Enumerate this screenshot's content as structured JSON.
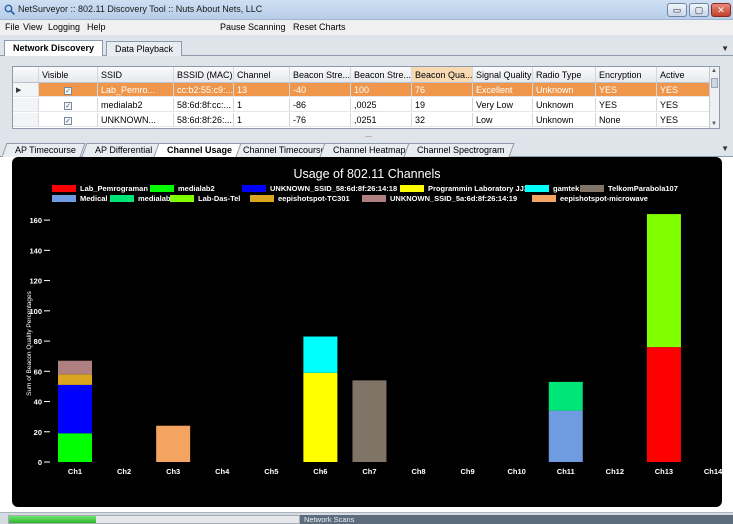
{
  "window": {
    "title": "NetSurveyor :: 802.11 Discovery Tool :: Nuts About Nets, LLC",
    "buttons": [
      "▭",
      "▢",
      "✕"
    ]
  },
  "menu": {
    "items": [
      "File",
      "View",
      "Logging",
      "Help"
    ],
    "actions": [
      "Pause Scanning",
      "Reset Charts"
    ]
  },
  "top_tabs": [
    "Network Discovery",
    "Data Playback"
  ],
  "grid": {
    "columns": [
      "Visible",
      "SSID",
      "BSSID (MAC)",
      "Channel",
      "Beacon Stre...",
      "Beacon Stre...",
      "Beacon Qua...",
      "Signal Quality",
      "Radio Type",
      "Encryption",
      "Active"
    ],
    "rows": [
      [
        "✓",
        "Lab_Pemro...",
        "cc:b2:55:c9:...",
        "13",
        "-40",
        "100",
        "76",
        "Excellent",
        "Unknown",
        "YES",
        "YES"
      ],
      [
        "✓",
        "medialab2",
        "58:6d:8f:cc:...",
        "1",
        "-86",
        ",0025",
        "19",
        "Very Low",
        "Unknown",
        "YES",
        "YES"
      ],
      [
        "✓",
        "UNKNOWN...",
        "58:6d:8f:26:...",
        "1",
        "-76",
        ",0251",
        "32",
        "Low",
        "Unknown",
        "None",
        "YES"
      ]
    ]
  },
  "chart_tabs": [
    "AP Timecourse",
    "AP Differential",
    "Channel Usage",
    "Channel Timecourse",
    "Channel Heatmap",
    "Channel Spectrogram"
  ],
  "chart_data": {
    "type": "bar",
    "title": "Usage of 802.11 Channels",
    "ylabel": "Sum of Beacon Quality Percentages",
    "xlabel": "",
    "categories": [
      "Ch1",
      "Ch2",
      "Ch3",
      "Ch4",
      "Ch5",
      "Ch6",
      "Ch7",
      "Ch8",
      "Ch9",
      "Ch10",
      "Ch11",
      "Ch12",
      "Ch13",
      "Ch14"
    ],
    "yticks": [
      0,
      20,
      40,
      60,
      80,
      100,
      120,
      140,
      160
    ],
    "ylim": [
      0,
      170
    ],
    "stacked": true,
    "series": [
      {
        "name": "Lab_Pemrograman",
        "color": "#ff0000",
        "values": [
          0,
          0,
          0,
          0,
          0,
          0,
          0,
          0,
          0,
          0,
          0,
          0,
          76,
          0
        ]
      },
      {
        "name": "medialab2",
        "color": "#00ff00",
        "values": [
          19,
          0,
          0,
          0,
          0,
          0,
          0,
          0,
          0,
          0,
          0,
          0,
          0,
          0
        ]
      },
      {
        "name": "UNKNOWN_SSID_58:6d:8f:26:14:18",
        "color": "#0000ff",
        "values": [
          32,
          0,
          0,
          0,
          0,
          0,
          0,
          0,
          0,
          0,
          0,
          0,
          0,
          0
        ]
      },
      {
        "name": "Programmin Laboratory JJ309",
        "color": "#ffff00",
        "values": [
          0,
          0,
          0,
          0,
          0,
          59,
          0,
          0,
          0,
          0,
          0,
          0,
          0,
          0
        ]
      },
      {
        "name": "gamtek",
        "color": "#00ffff",
        "values": [
          0,
          0,
          0,
          0,
          0,
          24,
          0,
          0,
          0,
          0,
          0,
          0,
          0,
          0
        ]
      },
      {
        "name": "TelkomParabola107",
        "color": "#807466",
        "values": [
          0,
          0,
          0,
          0,
          0,
          0,
          54,
          0,
          0,
          0,
          0,
          0,
          0,
          0
        ]
      },
      {
        "name": "Medical",
        "color": "#6f9be0",
        "values": [
          0,
          0,
          0,
          0,
          0,
          0,
          0,
          0,
          0,
          0,
          34,
          0,
          0,
          0
        ]
      },
      {
        "name": "medialab1",
        "color": "#00e676",
        "values": [
          0,
          0,
          0,
          0,
          0,
          0,
          0,
          0,
          0,
          0,
          19,
          0,
          0,
          0
        ]
      },
      {
        "name": "Lab-Das-Tel",
        "color": "#7fff00",
        "values": [
          0,
          0,
          0,
          0,
          0,
          0,
          0,
          0,
          0,
          0,
          0,
          0,
          88,
          0
        ]
      },
      {
        "name": "eepishotspot-TC301",
        "color": "#daa520",
        "values": [
          7,
          0,
          0,
          0,
          0,
          0,
          0,
          0,
          0,
          0,
          0,
          0,
          0,
          0
        ]
      },
      {
        "name": "UNKNOWN_SSID_5a:6d:8f:26:14:19",
        "color": "#b08080",
        "values": [
          9,
          0,
          0,
          0,
          0,
          0,
          0,
          0,
          0,
          0,
          0,
          0,
          0,
          0
        ]
      },
      {
        "name": "eepishotspot-microwave",
        "color": "#f4a460",
        "values": [
          0,
          0,
          24,
          0,
          0,
          0,
          0,
          0,
          0,
          0,
          0,
          0,
          0,
          0
        ]
      }
    ]
  },
  "status": {
    "progress": 0.3,
    "text": "Network Scans"
  }
}
